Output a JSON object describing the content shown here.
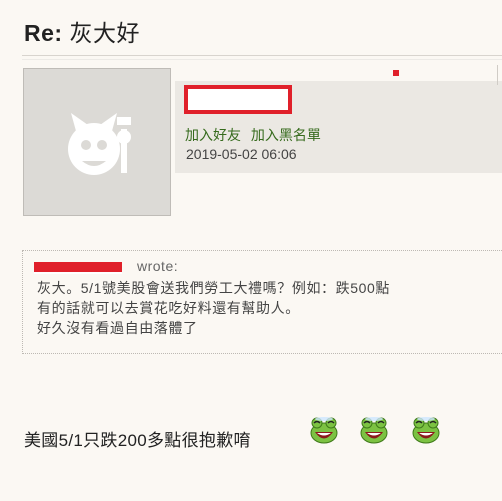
{
  "post": {
    "title_prefix": "Re:",
    "title_text": "灰大好"
  },
  "user": {
    "add_friend": "加入好友",
    "add_blacklist": "加入黑名單",
    "post_time": "2019-05-02 06:06"
  },
  "quote": {
    "head": "wrote:",
    "lines": [
      "灰大。5/1號美股會送我們勞工大禮嗎？例如：跌500點",
      "有的話就可以去賞花吃好料還有幫助人。",
      "好久沒有看過自由落體了"
    ]
  },
  "reply": {
    "text": "美國5/1只跌200多點很抱歉唷"
  },
  "icons": {
    "avatar": "default-avatar-icon",
    "emoji": "laughing-frog-emoji-icon"
  },
  "colors": {
    "accent_red": "#e0202a",
    "link_green": "#356a1c",
    "background": "#fbf8f3"
  }
}
